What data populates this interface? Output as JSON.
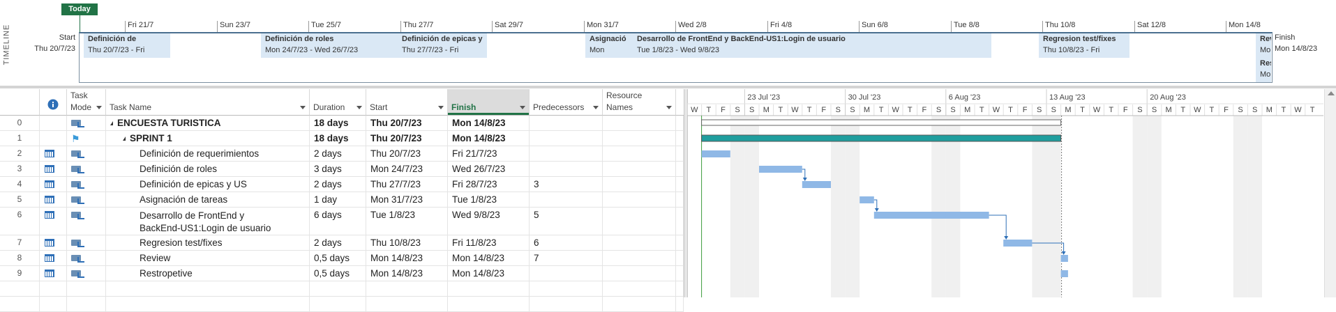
{
  "timeline": {
    "side_label": "TIMELINE",
    "today_label": "Today",
    "start_label": "Start",
    "start_date": "Thu 20/7/23",
    "finish_label": "Finish",
    "finish_date": "Mon 14/8/23",
    "ticks": [
      "Fri 21/7",
      "Sun 23/7",
      "Tue 25/7",
      "Thu 27/7",
      "Sat 29/7",
      "Mon 31/7",
      "Wed 2/8",
      "Fri 4/8",
      "Sun 6/8",
      "Tue 8/8",
      "Thu 10/8",
      "Sat 12/8",
      "Mon 14/8"
    ],
    "tasks": [
      {
        "name": "Definición de",
        "dates": "Thu 20/7/23 - Fri"
      },
      {
        "name": "Definición de roles",
        "dates": "Mon 24/7/23 - Wed 26/7/23"
      },
      {
        "name": "Definición de epicas y",
        "dates": "Thu 27/7/23 - Fri"
      },
      {
        "name": "Asignació",
        "dates": "Mon"
      },
      {
        "name": "Desarrollo de FrontEnd y BackEnd-US1:Login de usuario",
        "dates": "Tue 1/8/23 - Wed 9/8/23"
      },
      {
        "name": "Regresion test/fixes",
        "dates": "Thu 10/8/23 - Fri"
      },
      {
        "name": "Rev",
        "dates": "Mo"
      },
      {
        "name": "Res",
        "dates": "Mo"
      }
    ]
  },
  "grid": {
    "columns": {
      "info_icon": "info-icon",
      "mode_top": "Task",
      "mode_bottom": "Mode",
      "name": "Task Name",
      "duration": "Duration",
      "start": "Start",
      "finish": "Finish",
      "predecessors": "Predecessors",
      "resources_top": "Resource",
      "resources_bottom": "Names"
    },
    "rows": [
      {
        "id": "0",
        "name": "ENCUESTA TURISTICA",
        "duration": "18 days",
        "start": "Thu 20/7/23",
        "finish": "Mon 14/8/23",
        "pred": "",
        "bold": true,
        "level": 0,
        "icon": "auto"
      },
      {
        "id": "1",
        "name": "SPRINT 1",
        "duration": "18 days",
        "start": "Thu 20/7/23",
        "finish": "Mon 14/8/23",
        "pred": "",
        "bold": true,
        "level": 1,
        "icon": "pin"
      },
      {
        "id": "2",
        "name": "Definición de requerimientos",
        "duration": "2 days",
        "start": "Thu 20/7/23",
        "finish": "Fri 21/7/23",
        "pred": "",
        "level": 2,
        "icon": "auto"
      },
      {
        "id": "3",
        "name": "Definición de roles",
        "duration": "3 days",
        "start": "Mon 24/7/23",
        "finish": "Wed 26/7/23",
        "pred": "",
        "level": 2,
        "icon": "auto"
      },
      {
        "id": "4",
        "name": "Definición de epicas y US",
        "duration": "2 days",
        "start": "Thu 27/7/23",
        "finish": "Fri 28/7/23",
        "pred": "3",
        "level": 2,
        "icon": "auto"
      },
      {
        "id": "5",
        "name": "Asignación de tareas",
        "duration": "1 day",
        "start": "Mon 31/7/23",
        "finish": "Tue 1/8/23",
        "pred": "",
        "level": 2,
        "icon": "auto"
      },
      {
        "id": "6",
        "name": "Desarrollo de FrontEnd y",
        "name2": "BackEnd-US1:Login de usuario",
        "duration": "6 days",
        "start": "Tue 1/8/23",
        "finish": "Wed 9/8/23",
        "pred": "5",
        "level": 2,
        "icon": "auto"
      },
      {
        "id": "7",
        "name": "Regresion test/fixes",
        "duration": "2 days",
        "start": "Thu 10/8/23",
        "finish": "Fri 11/8/23",
        "pred": "6",
        "level": 2,
        "icon": "auto"
      },
      {
        "id": "8",
        "name": "Review",
        "duration": "0,5 days",
        "start": "Mon 14/8/23",
        "finish": "Mon 14/8/23",
        "pred": "7",
        "level": 2,
        "icon": "auto"
      },
      {
        "id": "9",
        "name": "Restropetive",
        "duration": "0,5 days",
        "start": "Mon 14/8/23",
        "finish": "Mon 14/8/23",
        "pred": "",
        "level": 2,
        "icon": "auto"
      }
    ]
  },
  "gantt": {
    "weeks": [
      "23 Jul '23",
      "30 Jul '23",
      "6 Aug '23",
      "13 Aug '23",
      "20 Aug '23"
    ],
    "day_letters": [
      "W",
      "T",
      "F",
      "S",
      "S",
      "M",
      "T",
      "W",
      "T",
      "F",
      "S",
      "S",
      "M",
      "T",
      "W",
      "T",
      "F",
      "S",
      "S",
      "M",
      "T",
      "W",
      "T",
      "F",
      "S",
      "S",
      "M",
      "T",
      "W",
      "T",
      "F",
      "S",
      "S",
      "M",
      "T",
      "W",
      "T",
      "F",
      "S",
      "S",
      "M",
      "T",
      "W",
      "T"
    ],
    "first_day": "Wed 19/7/23",
    "bars": [
      {
        "row": 0,
        "type": "summary",
        "start": 1,
        "end": 26
      },
      {
        "row": 1,
        "type": "sprint",
        "start": 1,
        "end": 26
      },
      {
        "row": 2,
        "type": "task",
        "start": 1,
        "end": 3
      },
      {
        "row": 3,
        "type": "task",
        "start": 5,
        "end": 8
      },
      {
        "row": 4,
        "type": "task",
        "start": 8,
        "end": 10
      },
      {
        "row": 5,
        "type": "task",
        "start": 12,
        "end": 13
      },
      {
        "row": 6,
        "type": "task",
        "start": 13,
        "end": 21
      },
      {
        "row": 7,
        "type": "task",
        "start": 22,
        "end": 24
      },
      {
        "row": 8,
        "type": "task",
        "start": 26,
        "end": 26.5
      },
      {
        "row": 9,
        "type": "task",
        "start": 26,
        "end": 26.5
      }
    ],
    "links": [
      [
        3,
        4
      ],
      [
        5,
        6
      ],
      [
        6,
        7
      ],
      [
        7,
        8
      ]
    ],
    "colors": {
      "task": "#8fb8e6",
      "sprint": "#1f9e9e",
      "summary": "#666666",
      "weekend": "#f0f0f0",
      "link": "#2e6fb7"
    }
  }
}
